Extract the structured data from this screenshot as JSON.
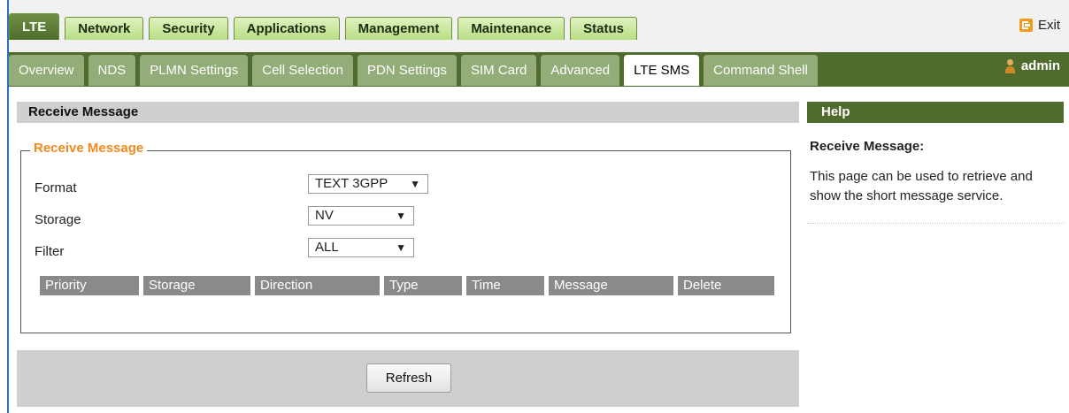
{
  "main_tabs": [
    "LTE",
    "Network",
    "Security",
    "Applications",
    "Management",
    "Maintenance",
    "Status"
  ],
  "exit_label": "Exit",
  "sub_tabs": [
    "Overview",
    "NDS",
    "PLMN Settings",
    "Cell Selection",
    "PDN Settings",
    "SIM Card",
    "Advanced",
    "LTE SMS",
    "Command Shell"
  ],
  "user": "admin",
  "section": {
    "title": "Receive Message",
    "legend": "Receive Message"
  },
  "form": {
    "format_label": "Format",
    "format_value": "TEXT 3GPP",
    "storage_label": "Storage",
    "storage_value": "NV",
    "filter_label": "Filter",
    "filter_value": "ALL"
  },
  "table_headers": [
    "Priority",
    "Storage",
    "Direction",
    "Type",
    "Time",
    "Message",
    "Delete"
  ],
  "refresh_label": "Refresh",
  "help": {
    "header": "Help",
    "title": "Receive Message:",
    "text": "This page can be used to retrieve and show the short message service."
  },
  "icons": {
    "exit": "exit-icon",
    "user": "user-icon",
    "dropdown": "chevron-down-icon"
  },
  "colors": {
    "dark_green": "#4f6b2d",
    "light_green_tab": "#b9dd84",
    "subtab": "#93ac78",
    "legend_orange": "#f08a1e",
    "frame_blue": "#2f73b6"
  }
}
